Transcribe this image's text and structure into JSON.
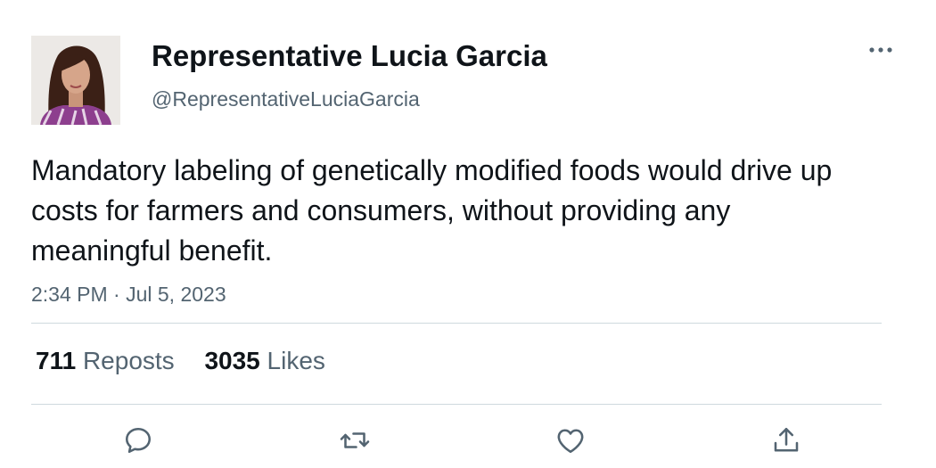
{
  "author": {
    "display_name": "Representative Lucia Garcia",
    "handle": "@RepresentativeLuciaGarcia"
  },
  "post": {
    "text": "Mandatory labeling of genetically modified foods would drive up costs for farmers and consumers, without providing any meaningful benefit.",
    "timestamp": "2:34 PM · Jul 5, 2023"
  },
  "stats": {
    "reposts_count": "711",
    "reposts_label": "Reposts",
    "likes_count": "3035",
    "likes_label": "Likes"
  },
  "icons": {
    "more": "more-horizontal-icon",
    "reply": "reply-icon",
    "repost": "repost-icon",
    "like": "heart-icon",
    "share": "share-icon"
  },
  "colors": {
    "text_primary": "#0f1419",
    "text_secondary": "#536471",
    "divider": "#cfd9de"
  }
}
